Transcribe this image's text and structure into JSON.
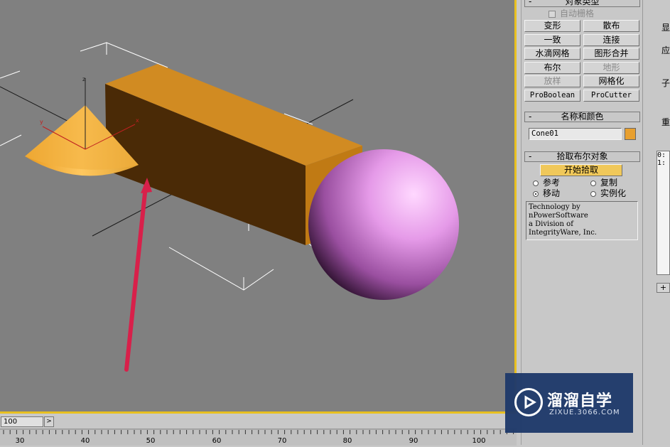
{
  "toolbar_rollouts": {
    "object_type": {
      "title": "对象类型",
      "autogrid_label": "自动栅格",
      "buttons": [
        "变形",
        "散布",
        "一致",
        "连接",
        "水滴网格",
        "图形合并",
        "布尔",
        "地形",
        "放样",
        "网格化",
        "ProBoolean",
        "ProCutter"
      ]
    },
    "name_color": {
      "title": "名称和颜色",
      "name_value": "Cone01",
      "color": "#e8a030"
    },
    "pick_boolean": {
      "title": "拾取布尔对象",
      "start_pick_label": "开始拾取",
      "options": [
        "参考",
        "复制",
        "移动",
        "实例化"
      ],
      "selected_option": "移动"
    },
    "credit_lines": [
      "Technology by",
      "nPowerSoftware",
      "a Division of",
      "IntegrityWare, Inc."
    ],
    "minus": "-"
  },
  "right_strip": {
    "labels": [
      "显",
      "应",
      "子",
      "重"
    ],
    "list_items": [
      "0:",
      "1:"
    ],
    "plus_label": "+"
  },
  "timeline": {
    "frame_value": "100",
    "next_arrow": ">",
    "tick_labels": [
      "30",
      "40",
      "50",
      "60",
      "70",
      "80",
      "90",
      "100"
    ]
  },
  "watermark": {
    "title": "溜溜自学",
    "url": "ZIXUE.3066.COM"
  },
  "viewport": {
    "axis_labels": [
      "z",
      "y",
      "x"
    ]
  },
  "colors": {
    "viewport_bg": "#808080",
    "active_border": "#e8c020",
    "start_pick_bg": "#f0c85a",
    "box": "#c8821c",
    "sphere": "#d987d9",
    "arrow": "#d8204a"
  }
}
